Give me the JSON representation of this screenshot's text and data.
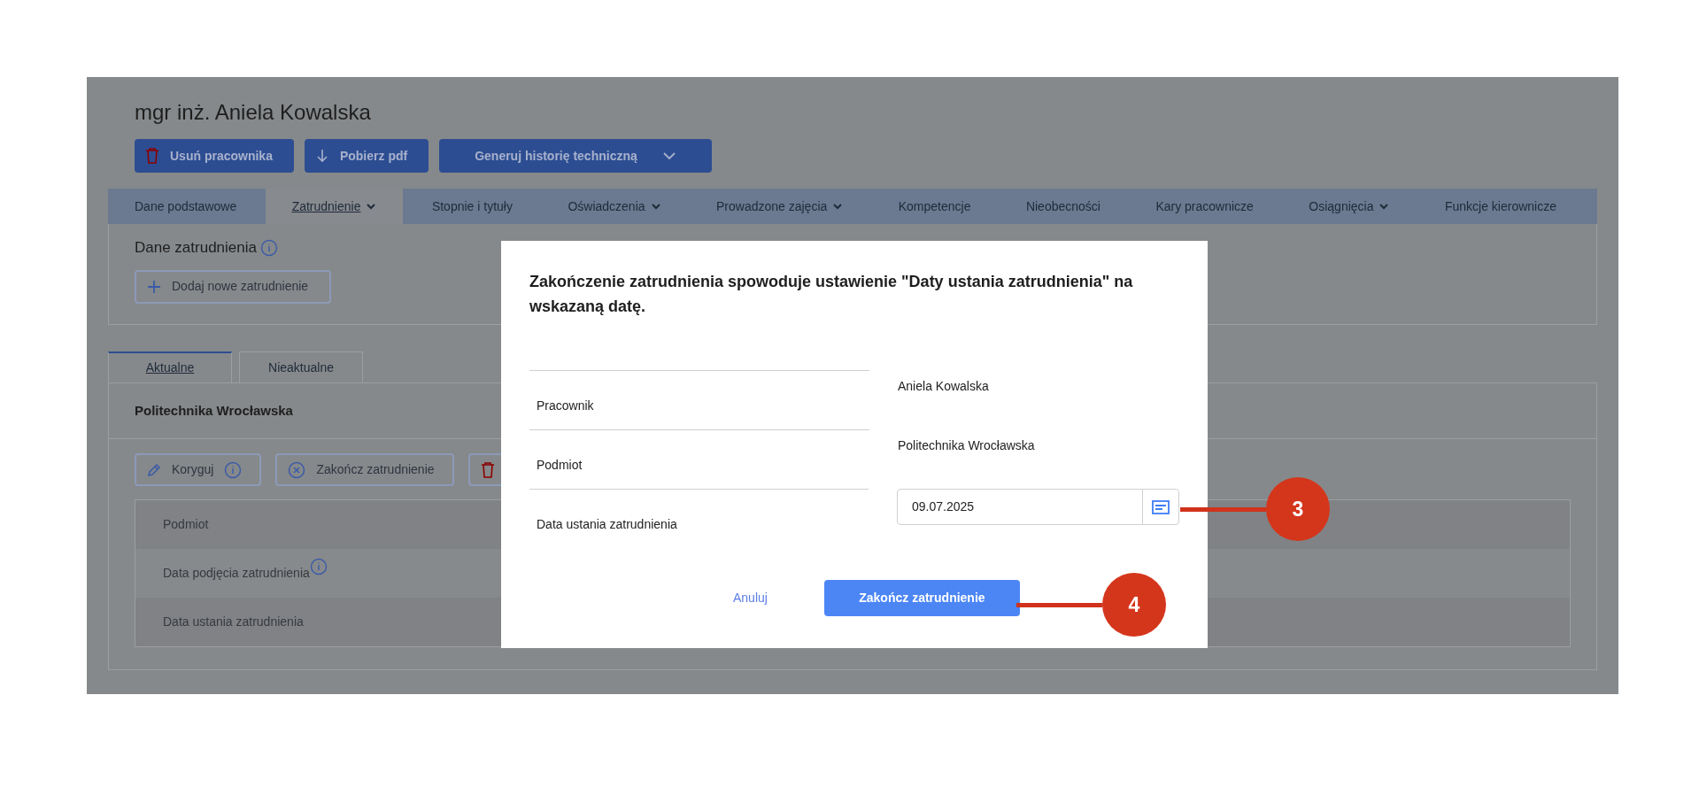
{
  "page_title": "mgr inż. Aniela Kowalska",
  "actions": [
    {
      "kind": "delete",
      "label": "Usuń pracownika"
    },
    {
      "kind": "download",
      "label": "Pobierz pdf"
    },
    {
      "kind": "dropdown",
      "label": "Generuj historię techniczną"
    }
  ],
  "nav_tabs": [
    {
      "label": "Dane podstawowe",
      "selected": false,
      "has_menu": false
    },
    {
      "label": "Zatrudnienie",
      "selected": true,
      "has_menu": true
    },
    {
      "label": "Stopnie i tytuły",
      "selected": false,
      "has_menu": false
    },
    {
      "label": "Oświadczenia",
      "selected": false,
      "has_menu": true
    },
    {
      "label": "Prowadzone zajęcia",
      "selected": false,
      "has_menu": true
    },
    {
      "label": "Kompetencje",
      "selected": false,
      "has_menu": false
    },
    {
      "label": "Nieobecności",
      "selected": false,
      "has_menu": false
    },
    {
      "label": "Kary pracownicze",
      "selected": false,
      "has_menu": false
    },
    {
      "label": "Osiągnięcia",
      "selected": false,
      "has_menu": true
    },
    {
      "label": "Funkcje kierownicze",
      "selected": false,
      "has_menu": false
    }
  ],
  "employment_section": {
    "title": "Dane zatrudnienia",
    "add_button": "Dodaj nowe zatrudnienie"
  },
  "status_tabs": [
    {
      "label": "Aktualne",
      "selected": true
    },
    {
      "label": "Nieaktualne",
      "selected": false
    }
  ],
  "employment_card": {
    "title": "Politechnika Wrocławska",
    "actions": [
      {
        "kind": "edit",
        "label": "Koryguj",
        "info": true
      },
      {
        "kind": "end",
        "label": "Zakończ zatrudnienie",
        "info": false
      },
      {
        "kind": "delete"
      }
    ]
  },
  "table": {
    "rows": [
      {
        "label": "Podmiot",
        "info": false
      },
      {
        "label": "Data podjęcia zatrudnienia",
        "info": true
      },
      {
        "label": "Data ustania zatrudnienia",
        "info": false
      }
    ]
  },
  "dialog": {
    "message": "Zakończenie zatrudnienia spowoduje ustawienie \"Daty ustania zatrudnienia\" na wskazaną datę.",
    "rows": [
      {
        "kind": "text",
        "label": "Pracownik",
        "value": "Aniela Kowalska"
      },
      {
        "kind": "text",
        "label": "Podmiot",
        "value": "Politechnika Wrocławska"
      },
      {
        "kind": "date",
        "label": "Data ustania zatrudnienia",
        "value": "09.07.2025"
      }
    ],
    "cancel": "Anuluj",
    "confirm": "Zakończ zatrudnienie"
  },
  "callouts": [
    {
      "label": "3"
    },
    {
      "label": "4"
    }
  ]
}
